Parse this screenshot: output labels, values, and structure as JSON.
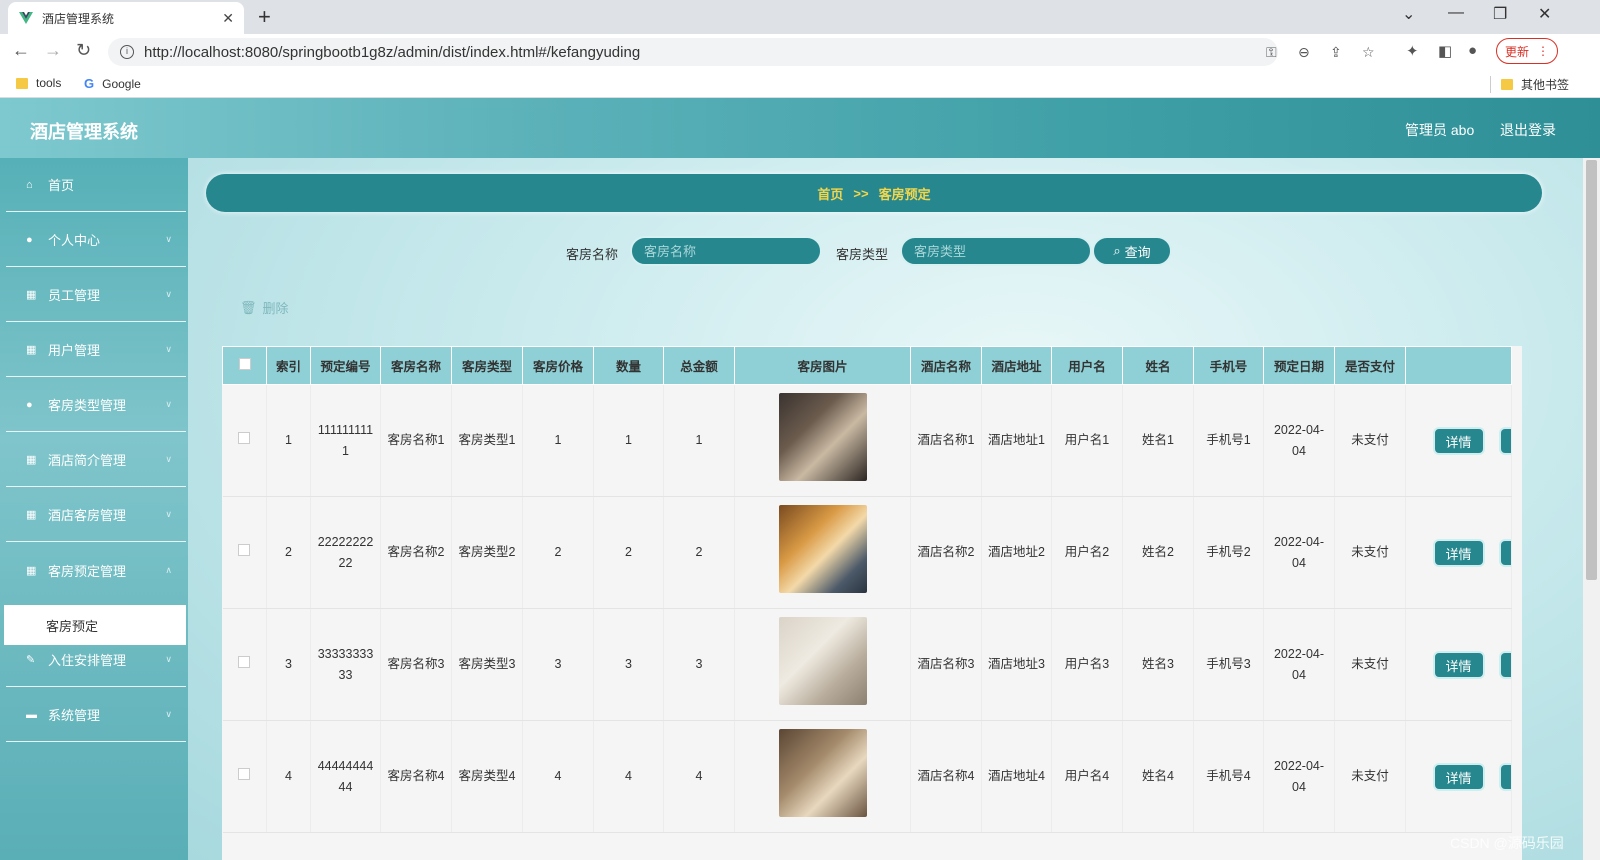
{
  "browser": {
    "tab_title": "酒店管理系统",
    "tab_close": "✕",
    "new_tab": "+",
    "url": "http://localhost:8080/springbootb1g8z/admin/dist/index.html#/kefangyuding",
    "update_label": "更新",
    "bookmarks": [
      "tools",
      "Google"
    ],
    "other_bookmarks": "其他书签"
  },
  "header": {
    "title": "酒店管理系统",
    "admin": "管理员 abo",
    "logout": "退出登录"
  },
  "sidebar": {
    "items": [
      {
        "label": "首页",
        "icon": "home-icon"
      },
      {
        "label": "个人中心",
        "icon": "user-icon"
      },
      {
        "label": "员工管理",
        "icon": "grid-icon"
      },
      {
        "label": "用户管理",
        "icon": "grid-icon"
      },
      {
        "label": "客房类型管理",
        "icon": "user-icon"
      },
      {
        "label": "酒店简介管理",
        "icon": "grid-icon"
      },
      {
        "label": "酒店客房管理",
        "icon": "grid-icon"
      },
      {
        "label": "客房预定管理",
        "icon": "grid-icon"
      },
      {
        "label": "入住安排管理",
        "icon": "edit-icon"
      },
      {
        "label": "系统管理",
        "icon": "briefcase-icon"
      }
    ],
    "submenu": "客房预定"
  },
  "breadcrumb": {
    "home": "首页",
    "sep": ">>",
    "current": "客房预定"
  },
  "search": {
    "name_label": "客房名称",
    "name_placeholder": "客房名称",
    "type_label": "客房类型",
    "type_placeholder": "客房类型",
    "query": "查询"
  },
  "actions": {
    "delete": "删除",
    "detail": "详情"
  },
  "table": {
    "headers": [
      "索引",
      "预定编号",
      "客房名称",
      "客房类型",
      "客房价格",
      "数量",
      "总金额",
      "客房图片",
      "酒店名称",
      "酒店地址",
      "用户名",
      "姓名",
      "手机号",
      "预定日期",
      "是否支付"
    ],
    "rows": [
      {
        "index": "1",
        "code": "1111111111",
        "room_name": "客房名称1",
        "room_type": "客房类型1",
        "price": "1",
        "qty": "1",
        "total": "1",
        "hotel": "酒店名称1",
        "address": "酒店地址1",
        "username": "用户名1",
        "name": "姓名1",
        "phone": "手机号1",
        "date": "2022-04-04",
        "paid": "未支付"
      },
      {
        "index": "2",
        "code": "2222222222",
        "room_name": "客房名称2",
        "room_type": "客房类型2",
        "price": "2",
        "qty": "2",
        "total": "2",
        "hotel": "酒店名称2",
        "address": "酒店地址2",
        "username": "用户名2",
        "name": "姓名2",
        "phone": "手机号2",
        "date": "2022-04-04",
        "paid": "未支付"
      },
      {
        "index": "3",
        "code": "3333333333",
        "room_name": "客房名称3",
        "room_type": "客房类型3",
        "price": "3",
        "qty": "3",
        "total": "3",
        "hotel": "酒店名称3",
        "address": "酒店地址3",
        "username": "用户名3",
        "name": "姓名3",
        "phone": "手机号3",
        "date": "2022-04-04",
        "paid": "未支付"
      },
      {
        "index": "4",
        "code": "4444444444",
        "room_name": "客房名称4",
        "room_type": "客房类型4",
        "price": "4",
        "qty": "4",
        "total": "4",
        "hotel": "酒店名称4",
        "address": "酒店地址4",
        "username": "用户名4",
        "name": "姓名4",
        "phone": "手机号4",
        "date": "2022-04-04",
        "paid": "未支付"
      }
    ]
  },
  "watermark": "CSDN @源码乐园",
  "colors": {
    "accent": "#27878e",
    "header_th": "#8fd0d6",
    "breadcrumb_text": "#f2d64b"
  }
}
